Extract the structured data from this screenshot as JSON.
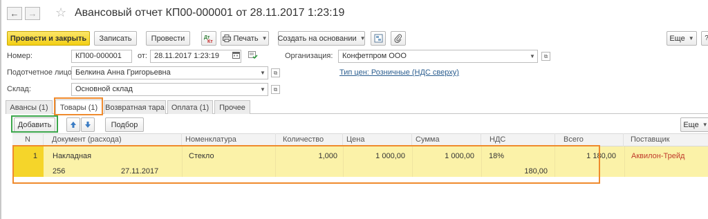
{
  "window": {
    "title": "Авансовый отчет КП00-000001 от 28.11.2017 1:23:19",
    "back_icon": "arrow-left",
    "forward_icon": "arrow-right",
    "favorite_icon": "star"
  },
  "toolbar": {
    "post_close": "Провести и закрыть",
    "save": "Записать",
    "post": "Провести",
    "print": "Печать",
    "create_based": "Создать на основании",
    "more": "Еще"
  },
  "form": {
    "number_label": "Номер:",
    "number_value": "КП00-000001",
    "date_label": "от:",
    "date_value": "28.11.2017  1:23:19",
    "org_label": "Организация:",
    "org_value": "Конфетпром ООО",
    "person_label": "Подотчетное лицо:",
    "person_value": "Белкина Анна Григорьевна",
    "price_link": "Тип цен: Розничные (НДС сверху)",
    "warehouse_label": "Склад:",
    "warehouse_value": "Основной склад"
  },
  "tabs": [
    "Авансы (1)",
    "Товары (1)",
    "Возвратная тара",
    "Оплата (1)",
    "Прочее"
  ],
  "table_toolbar": {
    "add": "Добавить",
    "select": "Подбор",
    "more": "Еще"
  },
  "table": {
    "headers": [
      "N",
      "Документ (расхода)",
      "Номенклатура",
      "Количество",
      "Цена",
      "Сумма",
      "НДС",
      "Всего",
      "Поставщик"
    ],
    "rows": [
      {
        "n": "1",
        "doc_type": "Накладная",
        "doc_number": "256",
        "doc_date": "27.11.2017",
        "item": "Стекло",
        "quantity": "1,000",
        "price": "1 000,00",
        "sum": "1 000,00",
        "vat_rate": "18%",
        "vat_amount": "180,00",
        "total": "1 180,00",
        "supplier": "Аквилон-Трейд"
      }
    ]
  },
  "colors": {
    "primary_button": "#f3cf15",
    "row_highlight": "#fbf2a8",
    "annotation_orange": "#ef8a2c",
    "annotation_green": "#3aa54a",
    "supplier_text": "#c0392b"
  }
}
